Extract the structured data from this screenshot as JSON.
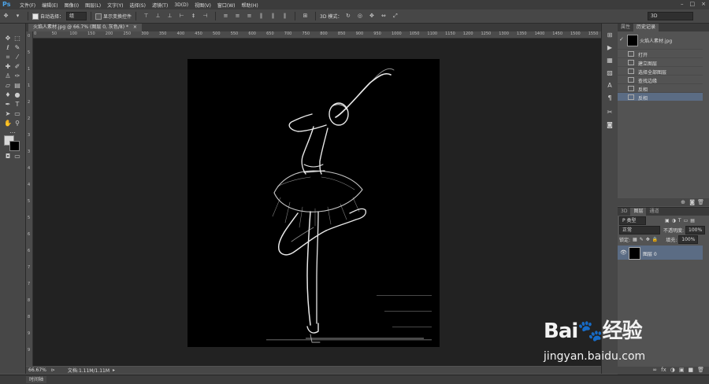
{
  "app": {
    "logo": "Ps"
  },
  "menu": [
    "文件(F)",
    "编辑(E)",
    "图像(I)",
    "图层(L)",
    "文字(Y)",
    "选择(S)",
    "滤镜(T)",
    "3D(D)",
    "视图(V)",
    "窗口(W)",
    "帮助(H)"
  ],
  "window_controls": [
    "–",
    "□",
    "×"
  ],
  "options": {
    "auto_select_label": "自动选择：",
    "auto_select_value": "组",
    "show_transform_label": "显示变换控件",
    "mode_3d_label": "3D 模式：",
    "workspace_value": "3D"
  },
  "document": {
    "tab_title": "火焰人素材.jpg @ 66.7% (图层 0, 灰色/8) *",
    "close_icon": "×"
  },
  "ruler": {
    "h_labels": [
      "0",
      "50",
      "100",
      "150",
      "200",
      "250",
      "300",
      "350",
      "400",
      "450",
      "500",
      "550",
      "600",
      "650",
      "700",
      "750",
      "800",
      "850",
      "900",
      "950",
      "1000",
      "1050",
      "1100",
      "1150",
      "1200",
      "1250",
      "1300",
      "1350",
      "1400",
      "1450",
      "1500",
      "1550"
    ],
    "v_labels": [
      "0",
      "5",
      "1",
      "1",
      "2",
      "2",
      "3",
      "3",
      "4",
      "4",
      "5",
      "5",
      "6",
      "6",
      "7",
      "7",
      "8",
      "8",
      "9",
      "9"
    ]
  },
  "status": {
    "zoom": "66.67%",
    "doc_size": "文档:1.11M/1.11M"
  },
  "timeline": {
    "label": "时间轴"
  },
  "history": {
    "tabs": [
      "属性",
      "历史记录"
    ],
    "snapshot_label": "火焰人素材.jpg",
    "items": [
      {
        "label": "打开",
        "active": false
      },
      {
        "label": "建立图层",
        "active": false
      },
      {
        "label": "选择全部图层",
        "active": false
      },
      {
        "label": "查找边缘",
        "active": false
      },
      {
        "label": "反相",
        "active": false
      },
      {
        "label": "反相",
        "active": true
      }
    ]
  },
  "layers": {
    "tabs": [
      "3D",
      "图层",
      "通道"
    ],
    "filter_label": "P 类型",
    "blend_mode": "正常",
    "opacity_label": "不透明度:",
    "opacity_value": "100%",
    "lock_label": "锁定:",
    "fill_label": "填充:",
    "fill_value": "100%",
    "layer_name": "图层 0",
    "footer_icons": [
      "∞",
      "fx",
      "◑",
      "▣",
      "■",
      "🗑"
    ]
  },
  "watermark": {
    "logo_text": "Bai🐾经验",
    "url": "jingyan.baidu.com"
  },
  "colors": {
    "accent": "#4ca3e7",
    "selection": "#5b6c84",
    "panel": "#535353",
    "canvas_bg": "#222222"
  }
}
